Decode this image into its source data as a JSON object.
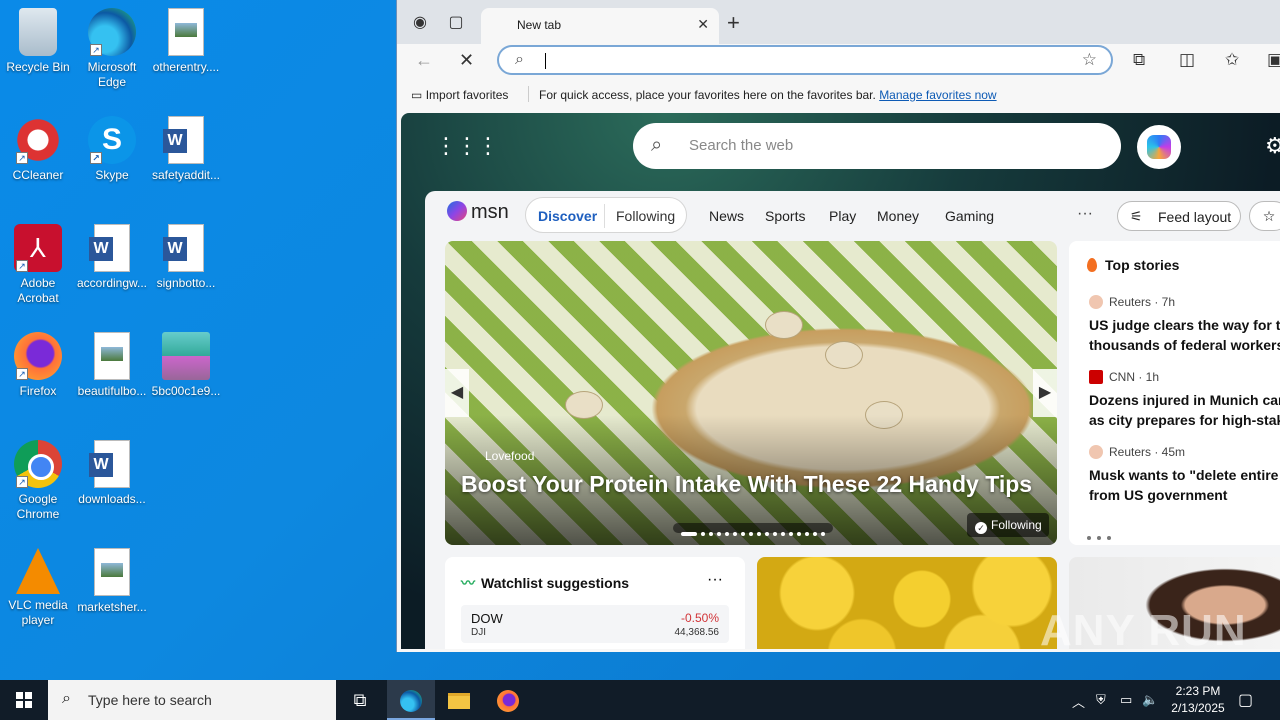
{
  "desktop": {
    "icons": [
      {
        "label": "Recycle Bin",
        "icon": "recycle-bin-icon"
      },
      {
        "label": "Microsoft Edge",
        "icon": "edge-icon"
      },
      {
        "label": "otherentry....",
        "icon": "image-file-icon"
      },
      {
        "label": "CCleaner",
        "icon": "ccleaner-icon"
      },
      {
        "label": "Skype",
        "icon": "skype-icon"
      },
      {
        "label": "safetyaddit...",
        "icon": "word-file-icon"
      },
      {
        "label": "Adobe Acrobat",
        "icon": "acrobat-icon"
      },
      {
        "label": "accordingw...",
        "icon": "word-file-icon"
      },
      {
        "label": "signbotto...",
        "icon": "word-file-icon"
      },
      {
        "label": "Firefox",
        "icon": "firefox-icon"
      },
      {
        "label": "beautifulbo...",
        "icon": "image-file-icon"
      },
      {
        "label": "5bc00c1e9...",
        "icon": "winrar-icon"
      },
      {
        "label": "Google Chrome",
        "icon": "chrome-icon"
      },
      {
        "label": "downloads...",
        "icon": "word-file-icon"
      },
      {
        "label": "VLC media player",
        "icon": "vlc-icon"
      },
      {
        "label": "marketsher...",
        "icon": "image-file-icon"
      }
    ]
  },
  "browser": {
    "tab_title": "New tab",
    "address_value": "",
    "favorites_bar": {
      "import_label": "Import favorites",
      "message": "For quick access, place your favorites here on the favorites bar.",
      "manage_link": "Manage favorites now"
    }
  },
  "ntp": {
    "search_placeholder": "Search the web",
    "logo": "msn",
    "tabs": {
      "discover": "Discover",
      "following": "Following"
    },
    "nav": [
      "News",
      "Sports",
      "Play",
      "Money",
      "Gaming"
    ],
    "more": "···",
    "feed_layout": "Feed layout",
    "hero": {
      "source": "Lovefood",
      "headline": "Boost Your Protein Intake With These 22 Handy Tips",
      "following": "Following"
    },
    "top_stories": {
      "heading": "Top stories",
      "items": [
        {
          "source": "Reuters · 7h",
          "line1": "US judge clears the way for ter",
          "line2": "thousands of federal workers t",
          "logo_color": "#f0c6b0"
        },
        {
          "source": "CNN · 1h",
          "line1": "Dozens injured in Munich car r",
          "line2": "as city prepares for high-stakes",
          "logo_color": "#cc0000"
        },
        {
          "source": "Reuters · 45m",
          "line1": "Musk wants to \"delete entire a",
          "line2": "from US government",
          "logo_color": "#f0c6b0"
        }
      ]
    },
    "watchlist": {
      "heading": "Watchlist suggestions",
      "symbol": "DOW",
      "sub": "DJI",
      "change": "-0.50%",
      "value": "44,368.56"
    }
  },
  "watermark": "ANY RUN",
  "taskbar": {
    "search_placeholder": "Type here to search",
    "time": "2:23 PM",
    "date": "2/13/2025"
  }
}
